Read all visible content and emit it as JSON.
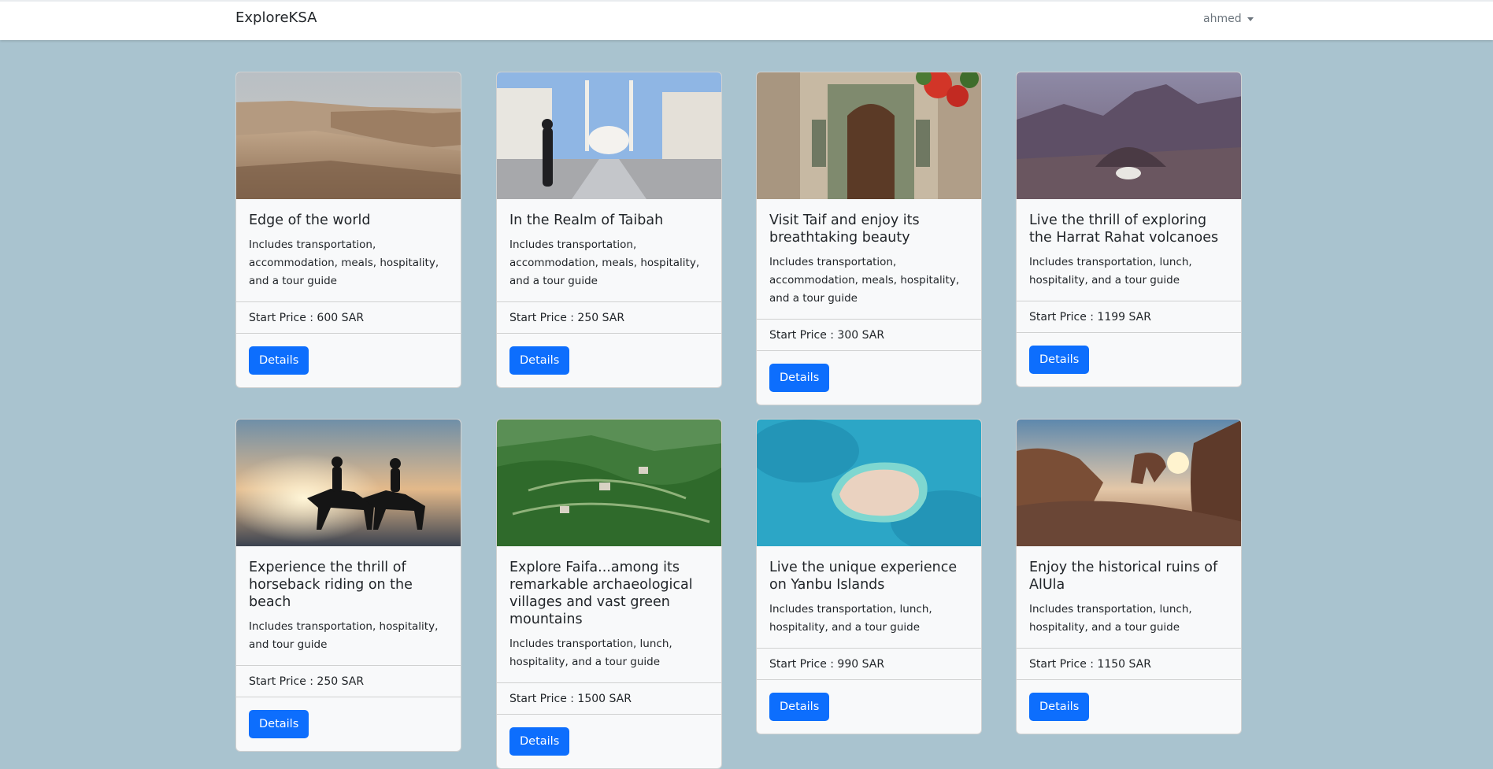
{
  "navbar": {
    "brand": "ExploreKSA",
    "user": "ahmed"
  },
  "price_label": "Start Price : ",
  "cards": [
    {
      "title": "Edge of the world",
      "description": "Includes transportation, accommodation, meals, hospitality, and a tour guide",
      "price": "600 SAR",
      "button": "Details",
      "image": "desert-cliffs-image"
    },
    {
      "title": "In the Realm of Taibah",
      "description": "Includes transportation, accommodation, meals, hospitality, and a tour guide",
      "price": "250 SAR",
      "button": "Details",
      "image": "mosque-promenade-image"
    },
    {
      "title": "Visit Taif and enjoy its breathtaking beauty",
      "description": "Includes transportation, accommodation, meals, hospitality, and a tour guide",
      "price": "300 SAR",
      "button": "Details",
      "image": "old-doorway-image"
    },
    {
      "title": "Live the thrill of exploring the Harrat Rahat volcanoes",
      "description": "Includes transportation, lunch, hospitality, and a tour guide",
      "price": "1199 SAR",
      "button": "Details",
      "image": "volcano-crater-image"
    },
    {
      "title": "Experience the thrill of horseback riding on the beach",
      "description": "Includes transportation, hospitality, and tour guide",
      "price": "250 SAR",
      "button": "Details",
      "image": "horse-riders-sunset-image"
    },
    {
      "title": "Explore Faifa...among its remarkable archaeological villages and vast green mountains",
      "description": "Includes transportation, lunch, hospitality, and a tour guide",
      "price": "1500 SAR",
      "button": "Details",
      "image": "green-mountains-image"
    },
    {
      "title": "Live the unique experience on Yanbu Islands",
      "description": "Includes transportation, lunch, hospitality, and a tour guide",
      "price": "990 SAR",
      "button": "Details",
      "image": "island-aerial-image"
    },
    {
      "title": "Enjoy the historical ruins of AlUla",
      "description": "Includes transportation, lunch, hospitality, and a tour guide",
      "price": "1150 SAR",
      "button": "Details",
      "image": "rock-arch-sunset-image"
    }
  ],
  "colors": {
    "background": "#a9c3cf",
    "primary": "#0d6efd",
    "card": "#f8f9fa"
  }
}
